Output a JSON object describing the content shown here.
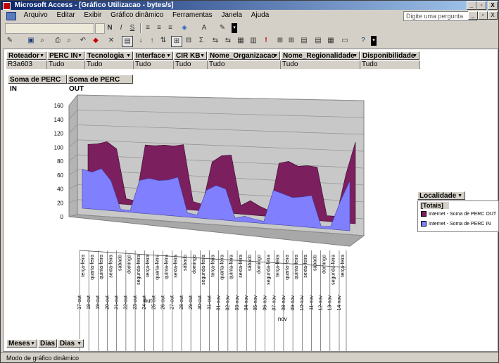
{
  "window": {
    "title": "Microsoft Access - [Gráfico Utilizacao - bytes/s]",
    "controls": [
      "_",
      "▫",
      "X"
    ]
  },
  "menu": {
    "items": [
      "Arquivo",
      "Editar",
      "Exibir",
      "Gráfico dinâmico",
      "Ferramentas",
      "Janela",
      "Ajuda"
    ],
    "help_placeholder": "Digite uma pergunta",
    "doc_controls": [
      "_",
      "▫",
      "X"
    ]
  },
  "filters": [
    {
      "name": "Roteador",
      "value": "R3a603"
    },
    {
      "name": "PERC IN",
      "value": "Tudo"
    },
    {
      "name": "Tecnologia",
      "value": "Tudo"
    },
    {
      "name": "Interface",
      "value": "Tudo"
    },
    {
      "name": "CIR KB",
      "value": "Tudo"
    },
    {
      "name": "Nome_Organizacao",
      "value": "Tudo"
    },
    {
      "name": "Nome_Regionalidade",
      "value": "Tudo"
    },
    {
      "name": "Disponibilidade",
      "value": "Tudo"
    }
  ],
  "data_fields": [
    "Soma de PERC IN",
    "Soma de PERC OUT"
  ],
  "legend": {
    "header": "Localidade",
    "total": "[Totais]",
    "entries": [
      {
        "label": "Internet - Soma de PERC OUT",
        "color": "#7b1f5e"
      },
      {
        "label": "Internet - Soma de PERC IN",
        "color": "#8080ff"
      }
    ]
  },
  "axis_fields": [
    "Meses",
    "Dias",
    "Dias"
  ],
  "status_text": "Modo de gráfico dinâmico",
  "chart_data": {
    "type": "area",
    "ylim": [
      0,
      160
    ],
    "yticks": [
      0,
      20,
      40,
      60,
      80,
      100,
      120,
      140,
      160
    ],
    "categories": [
      {
        "date": "17-out",
        "day": "terça-feira"
      },
      {
        "date": "18-out",
        "day": "quarta-feira"
      },
      {
        "date": "19-out",
        "day": "quinta-feira"
      },
      {
        "date": "20-out",
        "day": "sexta-feira"
      },
      {
        "date": "21-out",
        "day": "sábado"
      },
      {
        "date": "22-out",
        "day": "domingo"
      },
      {
        "date": "23-out",
        "day": "segunda-feira"
      },
      {
        "date": "24-out",
        "day": "terça-feira"
      },
      {
        "date": "25-out",
        "day": "quarta-feira"
      },
      {
        "date": "26-out",
        "day": "quinta-feira"
      },
      {
        "date": "27-out",
        "day": "sexta-feira"
      },
      {
        "date": "28-out",
        "day": "sábado"
      },
      {
        "date": "29-out",
        "day": "domingo"
      },
      {
        "date": "30-out",
        "day": "segunda-feira"
      },
      {
        "date": "31-out",
        "day": "terça-feira"
      },
      {
        "date": "01-nov",
        "day": "quarta-feira"
      },
      {
        "date": "02-nov",
        "day": "quinta-feira"
      },
      {
        "date": "03-nov",
        "day": "sexta-feira"
      },
      {
        "date": "04-nov",
        "day": "sábado"
      },
      {
        "date": "05-nov",
        "day": "domingo"
      },
      {
        "date": "06-nov",
        "day": "segunda-feira"
      },
      {
        "date": "07-nov",
        "day": "terça-feira"
      },
      {
        "date": "08-nov",
        "day": "quarta-feira"
      },
      {
        "date": "09-nov",
        "day": "quinta-feira"
      },
      {
        "date": "10-nov",
        "day": "sexta-feira"
      },
      {
        "date": "11-nov",
        "day": "sábado"
      },
      {
        "date": "12-nov",
        "day": "domingo"
      },
      {
        "date": "13-nov",
        "day": "segunda-feira"
      },
      {
        "date": "14-nov",
        "day": "terça-feira"
      }
    ],
    "month_groups": [
      {
        "label": "out",
        "start": 0,
        "end": 14
      },
      {
        "label": "nov",
        "start": 15,
        "end": 28
      }
    ],
    "series": [
      {
        "name": "Internet - Soma de PERC IN",
        "color": "#8080ff",
        "values": [
          55,
          52,
          58,
          42,
          3,
          2,
          46,
          50,
          48,
          50,
          55,
          6,
          4,
          40,
          48,
          44,
          4,
          8,
          5,
          3,
          48,
          44,
          40,
          42,
          45,
          3,
          4,
          40,
          70
        ]
      },
      {
        "name": "Internet - Soma de PERC OUT",
        "color": "#7b1f5e",
        "values": [
          25,
          30,
          28,
          35,
          5,
          4,
          40,
          36,
          40,
          38,
          36,
          6,
          5,
          30,
          32,
          38,
          8,
          12,
          8,
          5,
          28,
          36,
          34,
          34,
          30,
          5,
          4,
          28,
          45
        ]
      }
    ]
  }
}
